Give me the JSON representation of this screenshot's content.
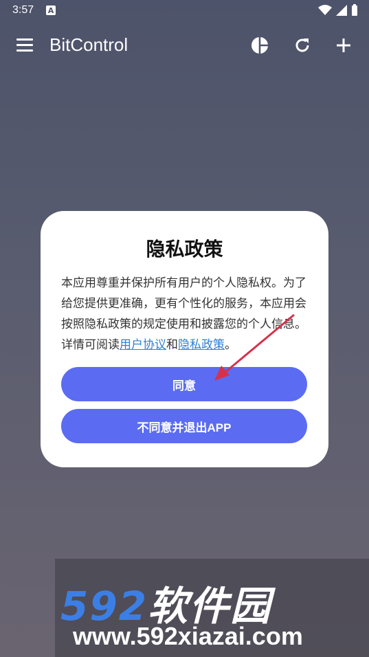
{
  "status_bar": {
    "time": "3:57",
    "notification_icon": "A"
  },
  "app_bar": {
    "title": "BitControl",
    "icons": [
      "menu-icon",
      "pie-chart-icon",
      "refresh-icon",
      "add-icon"
    ]
  },
  "dialog": {
    "title": "隐私政策",
    "body_text": "本应用尊重并保护所有用户的个人隐私权。为了给您提供更准确，更有个性化的服务，本应用会按照隐私政策的规定使用和披露您的个人信息。详情可阅读",
    "link_user_agreement": "用户协议",
    "conjunction": "和",
    "link_privacy_policy": "隐私政策",
    "end_punct": "。",
    "agree_button": "同意",
    "exit_button": "不同意并退出APP"
  },
  "watermark": {
    "brand_number": "592",
    "brand_cn": "软件园",
    "url": "www.592xiazai.com"
  },
  "colors": {
    "button": "#5b6cf2",
    "link": "#2f7fd6",
    "annotation_arrow": "#d6314a"
  }
}
